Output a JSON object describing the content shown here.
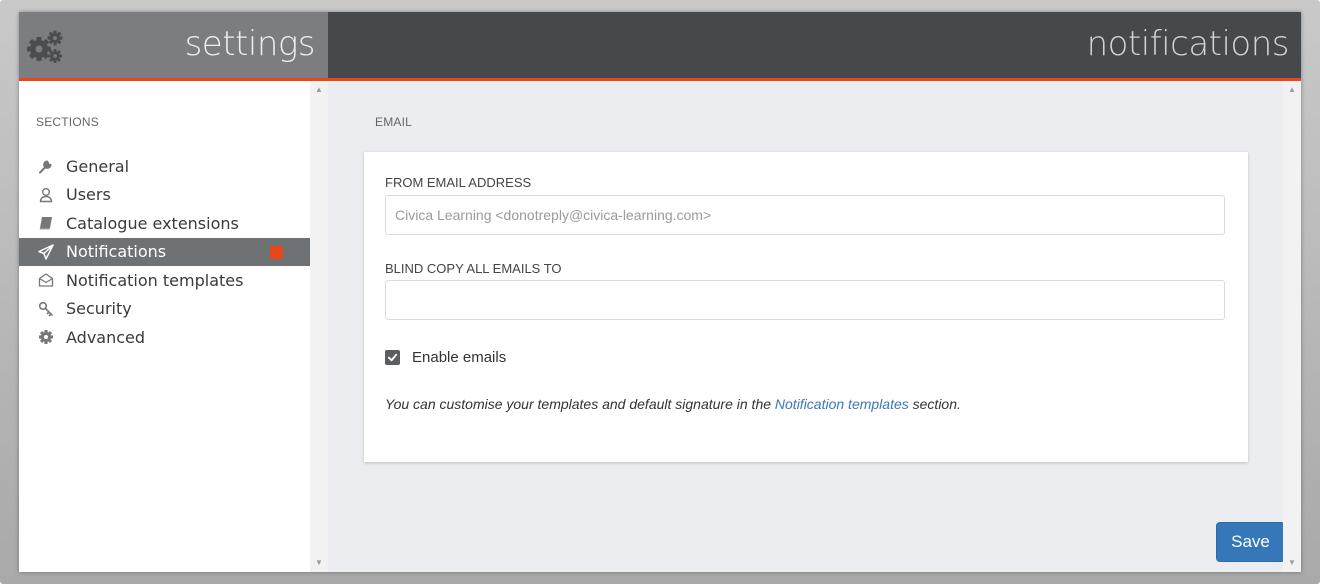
{
  "header": {
    "app_title": "settings",
    "page_title": "notifications",
    "app_icon": "gears-icon",
    "accent_color": "#e8461b"
  },
  "sidebar": {
    "heading": "SECTIONS",
    "items": [
      {
        "label": "General",
        "icon": "wrench-icon",
        "active": false
      },
      {
        "label": "Users",
        "icon": "user-icon",
        "active": false
      },
      {
        "label": "Catalogue extensions",
        "icon": "book-icon",
        "active": false
      },
      {
        "label": "Notifications",
        "icon": "paper-plane-icon",
        "active": true
      },
      {
        "label": "Notification templates",
        "icon": "envelope-open-icon",
        "active": false
      },
      {
        "label": "Security",
        "icon": "key-icon",
        "active": false
      },
      {
        "label": "Advanced",
        "icon": "cog-icon",
        "active": false
      }
    ]
  },
  "main": {
    "section_heading": "EMAIL",
    "from_email": {
      "label": "FROM EMAIL ADDRESS",
      "value": "",
      "placeholder": "Civica Learning <donotreply@civica-learning.com>"
    },
    "bcc": {
      "label": "BLIND COPY ALL EMAILS TO",
      "value": "",
      "placeholder": ""
    },
    "enable_emails": {
      "label": "Enable emails",
      "checked": true
    },
    "help": {
      "prefix": "You can customise your templates and default signature in the ",
      "link_text": "Notification templates",
      "suffix": " section."
    },
    "save_label": "Save"
  }
}
